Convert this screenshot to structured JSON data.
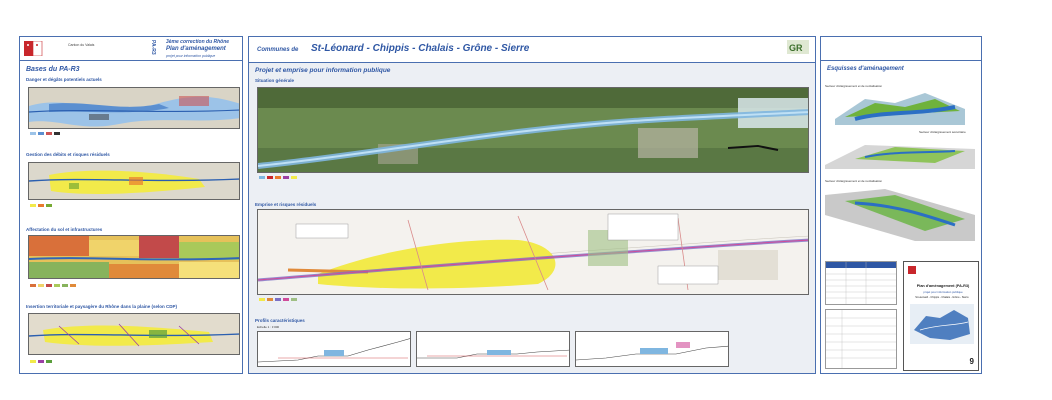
{
  "left": {
    "logo_text": "Canton du Valais",
    "header_code": "PA-R3",
    "header_line1": "3ème correction du Rhône",
    "header_line2": "Plan d'aménagement",
    "header_line3": "projet pour information publique",
    "title": "Bases du PA-R3",
    "sections": [
      {
        "title": "Danger et dégâts potentiels actuels"
      },
      {
        "title": "Gestion des débits et risques résiduels"
      },
      {
        "title": "Affectation du sol et infrastructures"
      },
      {
        "title": "Insertion territoriale et paysagère du Rhône dans la plaine (selon CDP)"
      }
    ]
  },
  "center": {
    "communes_prefix": "Communes de",
    "communes": "St-Léonard - Chippis - Chalais - Grône - Sierre",
    "logo": "GR",
    "main_title": "Projet et emprise pour information publique",
    "situation_title": "Situation générale",
    "emprise_title": "Emprise et risques résiduels",
    "profils_title": "Profils caractéristiques",
    "profils_sub": "Echelle 1 : 1'000"
  },
  "right": {
    "title": "Esquisses d'aménagement",
    "sketch1": "Secteur d'élargissement et de revitalisation",
    "sketch2": "Secteur d'élargissement sécuritaire",
    "sketch3": "Secteur d'élargissement et de revitalisation",
    "cartouche_title": "Plan d'aménagement (PA-R3)",
    "cartouche_sub": "projet pour information publique",
    "cartouche_communes": "St-Léonard - Chippis - Chalais - Grône - Sierre",
    "plan_number": "9"
  },
  "colors": {
    "accent": "#2f57a4",
    "border": "#4a6fb0",
    "hazard_blue": "#9cc3e8",
    "risk_yellow": "#f2ea4a",
    "river": "#7fb6e0"
  }
}
